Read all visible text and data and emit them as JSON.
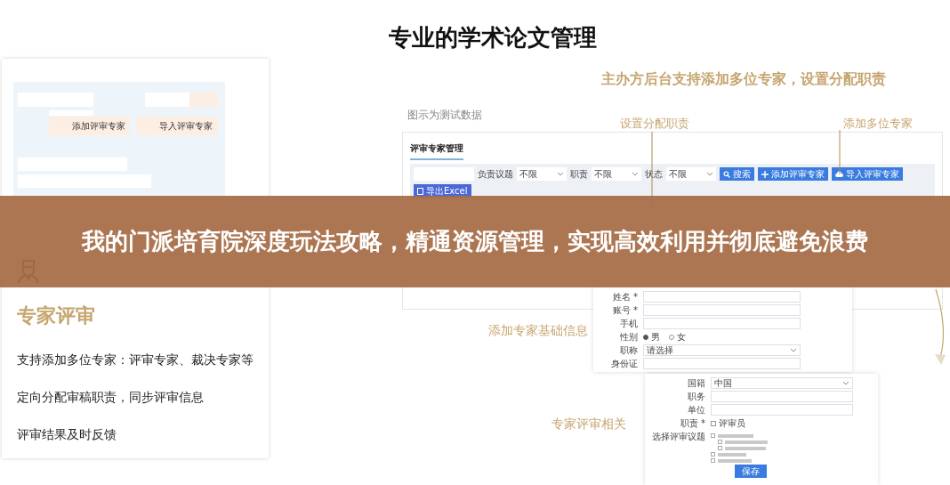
{
  "title": "专业的学术论文管理",
  "left_card": {
    "buttons": [
      "添加评审专家",
      "导入评审专家"
    ],
    "heading": "专家评审",
    "features": [
      "支持添加多位专家：评审专家、裁决专家等",
      "定向分配审稿职责，同步评审信息",
      "评审结果及时反馈"
    ]
  },
  "subtitle": "主办方后台支持添加多位专家，设置分配职责",
  "note": "图示为测试数据",
  "callouts": [
    "设置分配职责",
    "添加多位专家",
    "添加专家基础信息",
    "专家评审相关"
  ],
  "admin": {
    "title": "评审专家管理",
    "filters": [
      {
        "label": "负责议题",
        "value": "不限"
      },
      {
        "label": "职责",
        "value": "不限"
      },
      {
        "label": "状态",
        "value": "不限"
      }
    ],
    "buttons": [
      {
        "label": "搜索",
        "kind": "search"
      },
      {
        "label": "添加评审专家",
        "kind": "add"
      },
      {
        "label": "导入评审专家",
        "kind": "import"
      },
      {
        "label": "导出Excel",
        "kind": "export"
      }
    ]
  },
  "form_basic": {
    "fields": [
      {
        "label": "姓名 *",
        "kind": "text"
      },
      {
        "label": "账号 *",
        "kind": "text"
      },
      {
        "label": "手机",
        "kind": "text"
      },
      {
        "label": "性别",
        "kind": "radio",
        "options": [
          {
            "label": "男",
            "selected": true
          },
          {
            "label": "女",
            "selected": false
          }
        ]
      },
      {
        "label": "职称",
        "kind": "select",
        "value": "请选择"
      },
      {
        "label": "身份证",
        "kind": "text"
      }
    ]
  },
  "form_review": {
    "fields": [
      {
        "label": "国籍",
        "kind": "select",
        "value": "中国"
      },
      {
        "label": "职务",
        "kind": "text"
      },
      {
        "label": "单位",
        "kind": "text"
      },
      {
        "label": "职责 *",
        "kind": "checkbox",
        "options": [
          {
            "label": "评审员",
            "checked": false
          }
        ]
      }
    ],
    "topics_label": "选择评审议题",
    "topics": [
      {
        "checked": false,
        "children": [
          {
            "checked": false
          },
          {
            "checked": false
          }
        ]
      },
      {
        "checked": false
      },
      {
        "checked": false
      }
    ],
    "button": "保存"
  },
  "banner": "我的门派培育院深度玩法攻略，精通资源管理，实现高效利用并彻底避免浪费"
}
